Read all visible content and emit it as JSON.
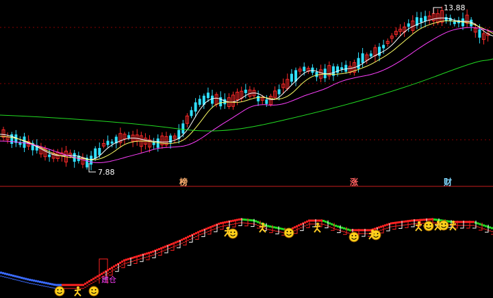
{
  "main_panel": {
    "high_price_label": "13.88",
    "low_price_label": "7.88",
    "marker_texts": [
      "榜",
      "涨",
      "财"
    ]
  },
  "indicator_panel": {
    "signal_label": "建仓"
  },
  "colors": {
    "background": "#000000",
    "grid": "#8b0000",
    "divider": "#c81e1e",
    "candle_up": "#ff2a2a",
    "candle_down": "#30e0ff",
    "ma_short": "#ffffff",
    "ma_mid": "#ffff66",
    "ma_long": "#ff40ff",
    "ma_120": "#22dd22",
    "marker_bang": "#ffb070",
    "marker_zhang": "#ff6060",
    "marker_cai": "#80d8ff",
    "ribbon_red": "#ff2222",
    "ribbon_green": "#22dd22",
    "ribbon_blue": "#3a6bff",
    "ribbon_hatch": "#ffffff",
    "label_magenta": "#ff40ff",
    "smiley": "#ffd21a",
    "runner": "#ffcc22"
  },
  "icons": {
    "smiley": "smiley-icon",
    "runner": "running-figure-icon"
  }
}
